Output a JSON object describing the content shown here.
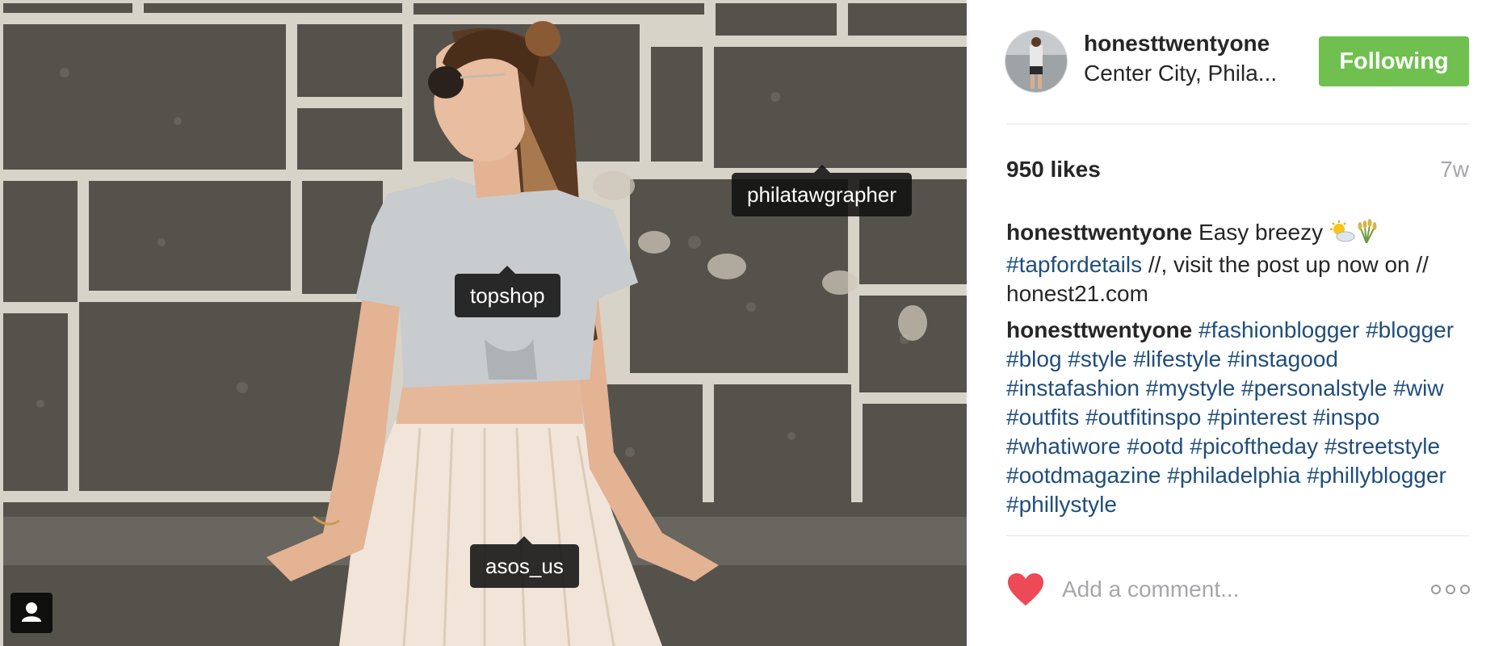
{
  "photo": {
    "tags": [
      {
        "label": "philatawgrapher"
      },
      {
        "label": "topshop"
      },
      {
        "label": "asos_us"
      }
    ],
    "user_tags_icon": "person-icon"
  },
  "header": {
    "username": "honesttwentyone",
    "location": "Center City, Phila...",
    "follow_label": "Following"
  },
  "stats": {
    "likes": "950 likes",
    "age": "7w"
  },
  "caption": {
    "user": "honesttwentyone",
    "text_before": "Easy breezy",
    "emoji": [
      "sun-behind-cloud-icon",
      "sheaf-of-rice-icon"
    ],
    "hashtag": "#tapfordetails",
    "text_after": "//, visit the post up now on // honest21.com"
  },
  "comments": [
    {
      "user": "honesttwentyone",
      "hashtags": [
        "#fashionblogger",
        "#blogger",
        "#blog",
        "#style",
        "#lifestyle",
        "#instagood",
        "#instafashion",
        "#mystyle",
        "#personalstyle",
        "#wiw",
        "#outfits",
        "#outfitinspo",
        "#pinterest",
        "#inspo",
        "#whatiwore",
        "#ootd",
        "#picoftheday",
        "#streetstyle",
        "#ootdmagazine",
        "#philadelphia",
        "#phillyblogger",
        "#phillystyle"
      ]
    }
  ],
  "actions": {
    "like_icon": "heart-icon",
    "comment_placeholder": "Add a comment...",
    "more_icon": "more-options-icon"
  },
  "colors": {
    "follow_button": "#70c050",
    "hashtag": "#1f4e7c",
    "heart": "#ed4956",
    "muted_text": "#a5a7aa"
  }
}
